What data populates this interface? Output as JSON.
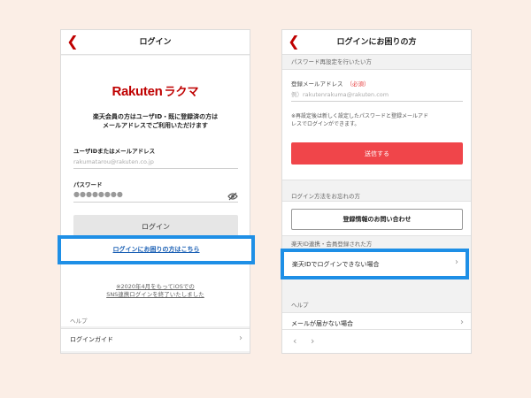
{
  "left": {
    "nav_title": "ログイン",
    "logo_wordmark": "Rakuten",
    "logo_rakuma": "ラクマ",
    "intro_line1": "楽天会員の方はユーザID・既に登録済の方は",
    "intro_line2": "メールアドレスでご利用いただけます",
    "user_label": "ユーザIDまたはメールアドレス",
    "user_placeholder": "rakumatarou@rakuten.co.jp",
    "password_label": "パスワード",
    "password_value": "●●●●●●●●",
    "login_button": "ログイン",
    "trouble_link": "ログインにお困りの方はこちら",
    "notice_line1": "※2020年4月をもってiOSでの",
    "notice_line2": "SNS連携ログインを終了いたしました",
    "help_title": "ヘルプ",
    "help_item": "ログインガイド"
  },
  "right": {
    "nav_title": "ログインにお困りの方",
    "section_reset": "パスワード再設定を行いたい方",
    "email_label": "登録メールアドレス",
    "email_required": "（必須）",
    "email_placeholder": "例）rakutenrakuma@rakuten.com",
    "note_line1": "※再設定後は新しく設定したパスワードと登録メールアド",
    "note_line2": "レスでログインができます。",
    "send_button": "送信する",
    "section_forgot": "ログイン方法をお忘れの方",
    "inquiry_button": "登録情報のお問い合わせ",
    "section_linked": "楽天ID連携・会員登録された方",
    "cannot_login": "楽天IDでログインできない場合",
    "section_help": "ヘルプ",
    "mail_not_arrived": "メールが届かない場合"
  },
  "icons": {
    "back": "chevron-left-icon",
    "eye": "eye-slash-icon",
    "row": "chevron-right-icon"
  },
  "colors": {
    "brand": "#bf0000",
    "highlight": "#1e8fe6",
    "send": "#f0454a"
  }
}
